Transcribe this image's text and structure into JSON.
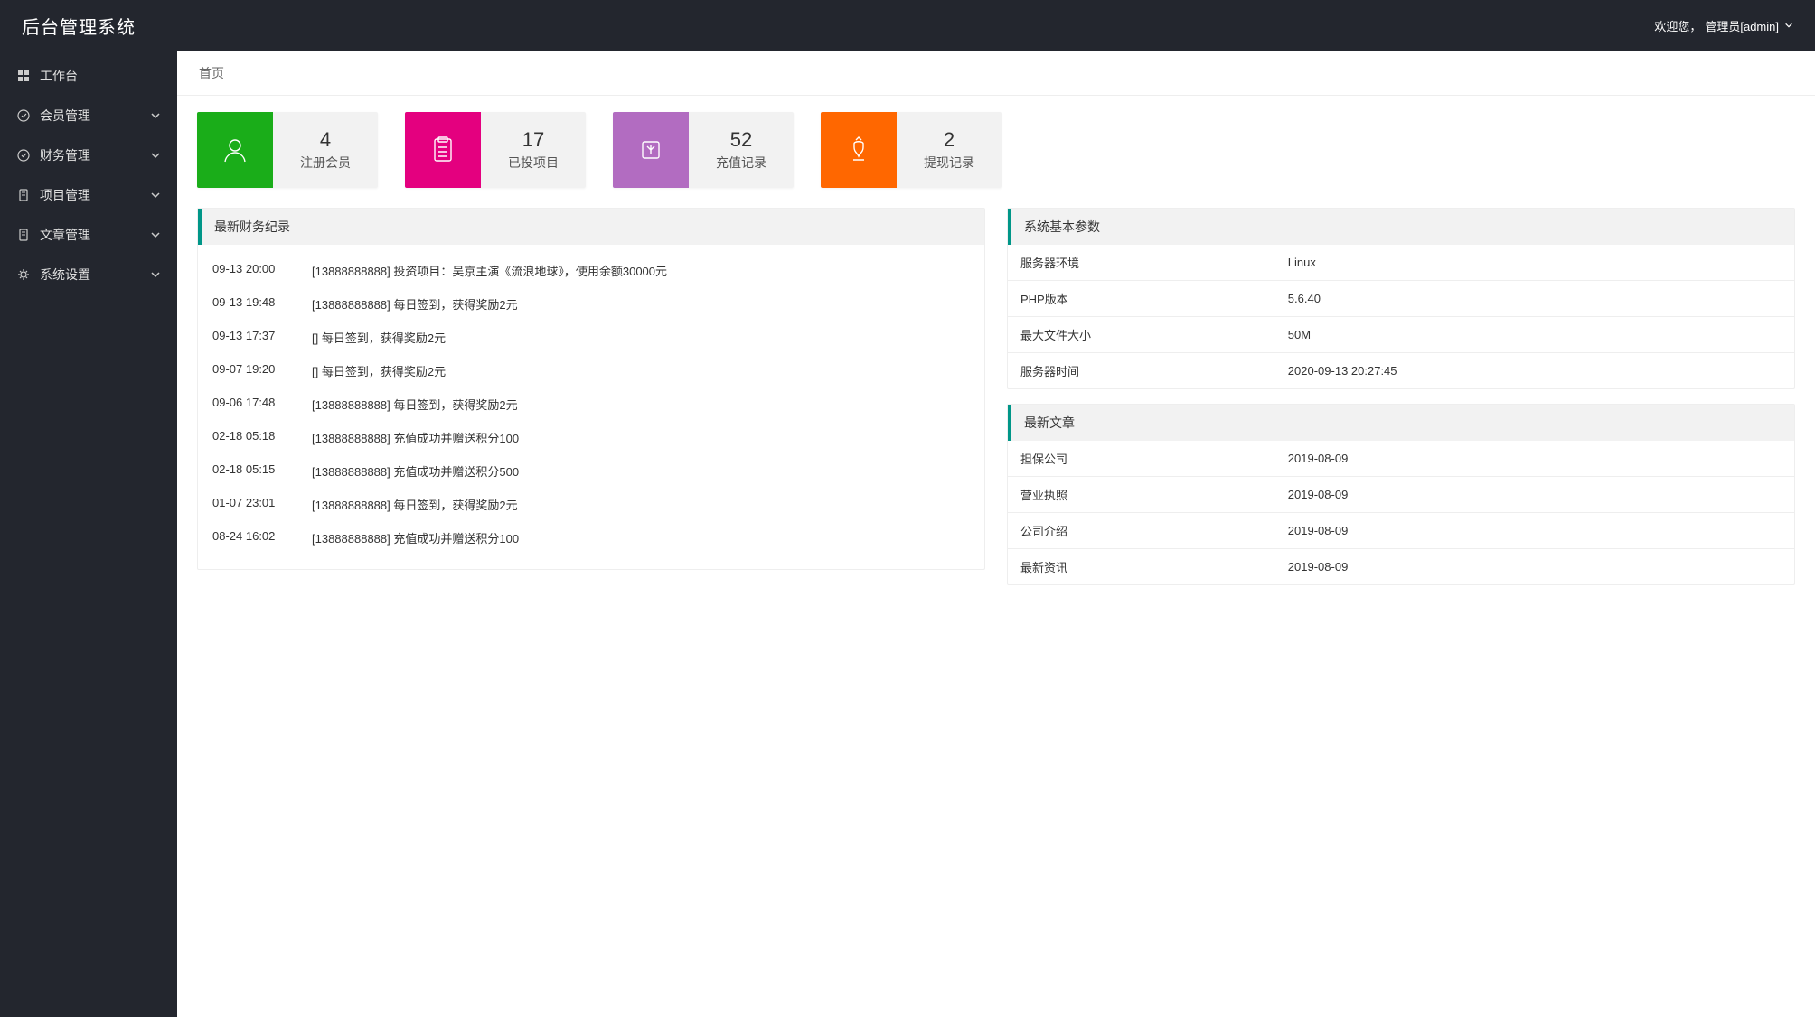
{
  "header": {
    "logo": "后台管理系统",
    "welcome_prefix": "欢迎您，",
    "welcome_user": "管理员[admin]"
  },
  "sidebar": {
    "items": [
      {
        "label": "工作台",
        "icon": "grid",
        "expandable": false
      },
      {
        "label": "会员管理",
        "icon": "badge",
        "expandable": true
      },
      {
        "label": "财务管理",
        "icon": "badge",
        "expandable": true
      },
      {
        "label": "项目管理",
        "icon": "file",
        "expandable": true
      },
      {
        "label": "文章管理",
        "icon": "file",
        "expandable": true
      },
      {
        "label": "系统设置",
        "icon": "gear",
        "expandable": true
      }
    ]
  },
  "breadcrumb": "首页",
  "stats": [
    {
      "count": "4",
      "label": "注册会员",
      "icon": "user",
      "color": "c-green"
    },
    {
      "count": "17",
      "label": "已投项目",
      "icon": "clip",
      "color": "c-pink"
    },
    {
      "count": "52",
      "label": "充值记录",
      "icon": "deposit",
      "color": "c-purple"
    },
    {
      "count": "2",
      "label": "提现记录",
      "icon": "withdraw",
      "color": "c-orange"
    }
  ],
  "finance_panel": {
    "title": "最新财务纪录",
    "rows": [
      {
        "time": "09-13 20:00",
        "msg": "[13888888888] 投资项目：吴京主演《流浪地球》，使用余额30000元"
      },
      {
        "time": "09-13 19:48",
        "msg": "[13888888888] 每日签到，获得奖励2元"
      },
      {
        "time": "09-13 17:37",
        "msg": "[] 每日签到，获得奖励2元"
      },
      {
        "time": "09-07 19:20",
        "msg": "[] 每日签到，获得奖励2元"
      },
      {
        "time": "09-06 17:48",
        "msg": "[13888888888] 每日签到，获得奖励2元"
      },
      {
        "time": "02-18 05:18",
        "msg": "[13888888888] 充值成功并赠送积分100"
      },
      {
        "time": "02-18 05:15",
        "msg": "[13888888888] 充值成功并赠送积分500"
      },
      {
        "time": "01-07 23:01",
        "msg": "[13888888888] 每日签到，获得奖励2元"
      },
      {
        "time": "08-24 16:02",
        "msg": "[13888888888] 充值成功并赠送积分100"
      }
    ]
  },
  "sysinfo_panel": {
    "title": "系统基本参数",
    "rows": [
      {
        "k": "服务器环境",
        "v": "Linux"
      },
      {
        "k": "PHP版本",
        "v": "5.6.40"
      },
      {
        "k": "最大文件大小",
        "v": "50M"
      },
      {
        "k": "服务器时间",
        "v": "2020-09-13 20:27:45"
      }
    ]
  },
  "articles_panel": {
    "title": "最新文章",
    "rows": [
      {
        "title": "担保公司",
        "date": "2019-08-09"
      },
      {
        "title": "营业执照",
        "date": "2019-08-09"
      },
      {
        "title": "公司介绍",
        "date": "2019-08-09"
      },
      {
        "title": "最新资讯",
        "date": "2019-08-09"
      }
    ]
  }
}
